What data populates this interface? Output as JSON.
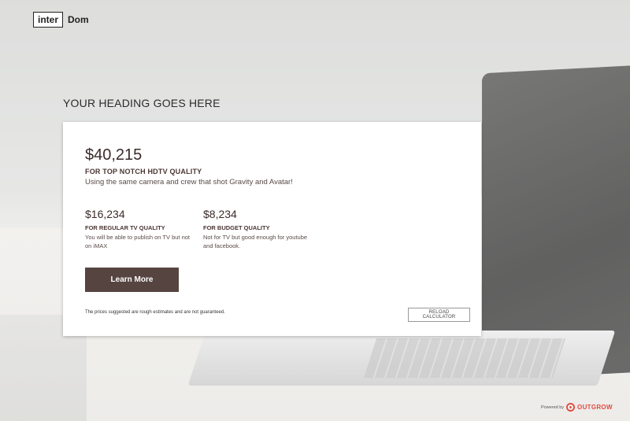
{
  "logo": {
    "box_text": "inter",
    "text": "Dom"
  },
  "heading": "YOUR HEADING GOES HERE",
  "result": {
    "main": {
      "price": "$40,215",
      "label": "FOR TOP NOTCH HDTV QUALITY",
      "description": "Using the same camera and crew that shot Gravity and Avatar!"
    },
    "options": [
      {
        "price": "$16,234",
        "label": "FOR REGULAR TV QUALITY",
        "description": "You will be able to publish on TV but not on iMAX"
      },
      {
        "price": "$8,234",
        "label": "FOR BUDGET QUALITY",
        "description": "Not for TV but good enough for youtube and facebook."
      }
    ],
    "learn_more_label": "Learn More",
    "disclaimer": "The prices suggested are rough estimates and are not guaranteed.",
    "reload_label": "RELOAD CALCULATOR"
  },
  "footer": {
    "powered_by": "Powered by",
    "brand": "OUTGROW",
    "icon": "outgrow-logo-icon"
  },
  "colors": {
    "button_bg": "#564440",
    "text_dark": "#3b2b2a",
    "brand": "#e04a3f"
  }
}
